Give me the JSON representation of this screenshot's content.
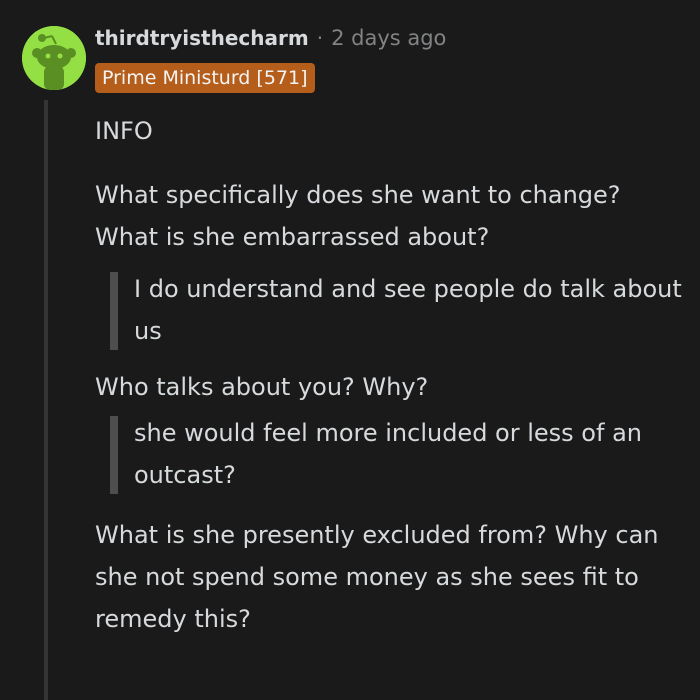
{
  "comment": {
    "author": "thirdtryisthecharm",
    "separator": "·",
    "timestamp": "2 days ago",
    "flair": "Prime Ministurd [571]",
    "paragraphs": {
      "info": "INFO",
      "q1": "What specifically does she want to change? What is she embarrassed about?",
      "quote1": "I do understand and see people do talk about us",
      "q2": "Who talks about you? Why?",
      "quote2": "she would feel more included or less of an outcast?",
      "q3": "What is she presently excluded from? Why can she not spend some money as she sees fit to remedy this?"
    }
  },
  "colors": {
    "background": "#1a1a1b",
    "text": "#d7dadc",
    "muted": "#818384",
    "flair_bg": "#b55d1a",
    "avatar_bg": "#94e044",
    "thread_line": "#343536",
    "quote_bar": "#4d4e4f"
  },
  "icons": {
    "avatar": "snoo-avatar-icon"
  }
}
